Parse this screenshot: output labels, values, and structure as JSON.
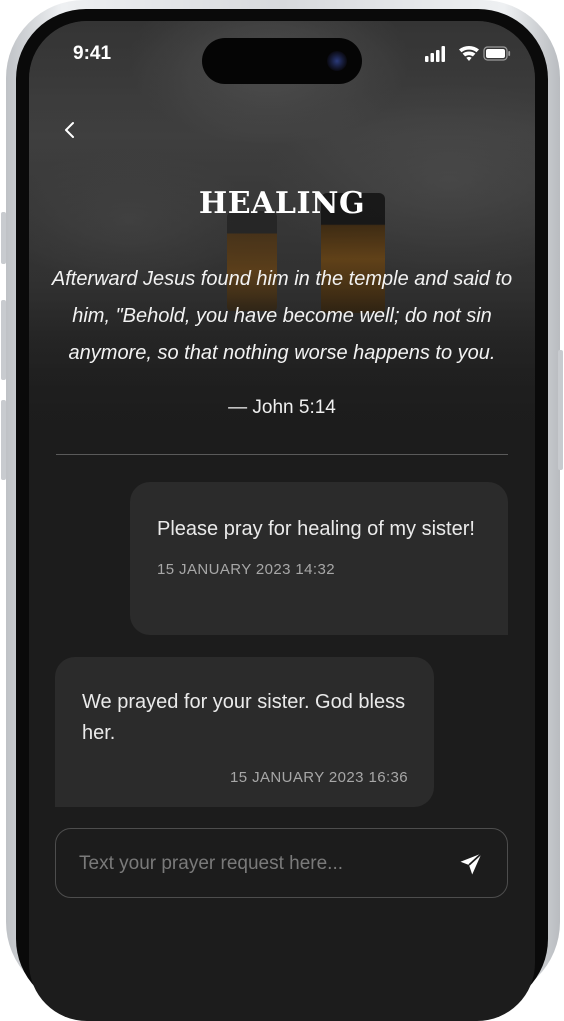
{
  "status": {
    "time": "9:41"
  },
  "header": {
    "back_icon": "chevron-left-icon"
  },
  "title": "HEALING",
  "verse": {
    "text": "Afterward Jesus found him in the temple and said to him, \"Behold, you have become well; do not sin anymore, so that nothing worse happens to you.",
    "reference": "— John 5:14"
  },
  "messages": [
    {
      "text": "Please pray for healing of my sister!",
      "timestamp": "15 JANUARY 2023 14:32"
    },
    {
      "text": "We prayed for your sister. God bless her.",
      "timestamp": "15 JANUARY 2023 16:36"
    }
  ],
  "composer": {
    "placeholder": "Text your prayer request here...",
    "value": "",
    "send_icon": "send-icon"
  },
  "colors": {
    "background": "#1c1c1c",
    "bubble": "#2b2b2b",
    "text": "#eaeaea",
    "muted": "#a7a7a7"
  }
}
